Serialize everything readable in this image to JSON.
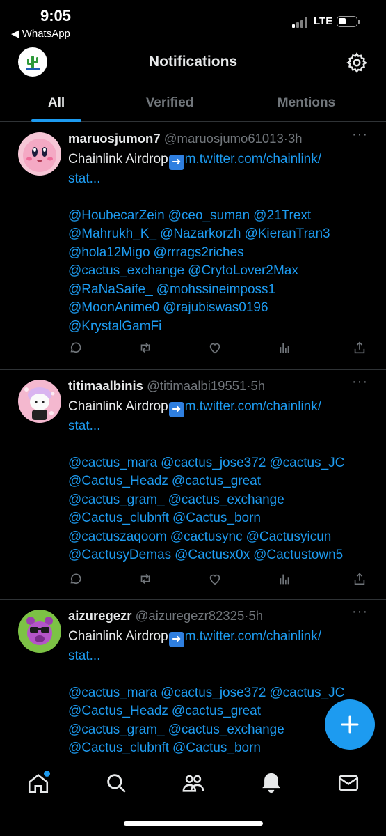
{
  "status_bar": {
    "time": "9:05",
    "back_app": "◀ WhatsApp",
    "network": "LTE"
  },
  "header": {
    "title": "Notifications",
    "logo_icon": "cactus-logo",
    "settings_icon": "gear-icon"
  },
  "tabs": [
    {
      "label": "All",
      "active": true
    },
    {
      "label": "Verified",
      "active": false
    },
    {
      "label": "Mentions",
      "active": false
    }
  ],
  "tweets": [
    {
      "name": "maruosjumon7",
      "handle": "@maruosjumo61013",
      "sep": "·",
      "time": "3h",
      "text_prefix": "Chainlink Airdrop",
      "link": "m.twitter.com/chainlink/",
      "link_tail": "stat...",
      "mentions": [
        "@HoubecarZein",
        "@ceo_suman",
        "@21Trext",
        "@Mahrukh_K_",
        "@Nazarkorzh",
        "@KieranTran3",
        "@hola12Migo",
        "@rrrags2riches",
        "@cactus_exchange",
        "@CrytoLover2Max",
        "@RaNaSaife_",
        "@mohssineimposs1",
        "@MoonAnime0",
        "@rajubiswas0196",
        "@KrystalGamFi"
      ]
    },
    {
      "name": "titimaalbinis",
      "handle": "@titimaalbi19551",
      "sep": "·",
      "time": "5h",
      "text_prefix": "Chainlink Airdrop",
      "link": "m.twitter.com/chainlink/",
      "link_tail": "stat...",
      "mentions": [
        "@cactus_mara",
        "@cactus_jose372",
        "@cactus_JC",
        "@Cactus_Headz",
        "@cactus_great",
        "@cactus_gram_",
        "@cactus_exchange",
        "@Cactus_clubnft",
        "@Cactus_born",
        "@cactuszaqoom",
        "@cactusync",
        "@Cactusyicun",
        "@CactusyDemas",
        "@Cactusx0x",
        "@Cactustown5"
      ]
    },
    {
      "name": "aizuregezr",
      "handle": "@aizuregezr82325",
      "sep": "·",
      "time": "5h",
      "text_prefix": "Chainlink Airdrop",
      "link": "m.twitter.com/chainlink/",
      "link_tail": "stat...",
      "mentions": [
        "@cactus_mara",
        "@cactus_jose372",
        "@cactus_JC",
        "@Cactus_Headz",
        "@cactus_great",
        "@cactus_gram_",
        "@cactus_exchange",
        "@Cactus_clubnft",
        "@Cactus_born"
      ]
    }
  ],
  "tweet_more": "···",
  "colors": {
    "accent": "#1d9bf0",
    "background": "#000000",
    "muted": "#71767b",
    "divider": "#2f3336"
  },
  "bottom_nav": [
    "home-icon",
    "search-icon",
    "communities-icon",
    "notifications-bell-icon",
    "messages-envelope-icon"
  ],
  "fab_icon": "compose-plus-icon"
}
